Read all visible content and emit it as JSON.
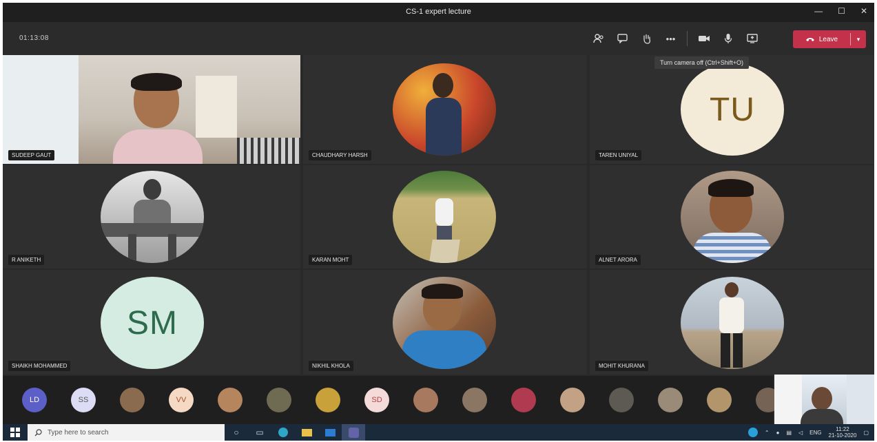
{
  "window": {
    "title": "CS-1 expert lecture",
    "controls": [
      "—",
      "☐",
      "✕"
    ]
  },
  "toolbar": {
    "timer": "01:13:08",
    "icons": [
      "participants-icon",
      "chat-icon",
      "raise-hand-icon",
      "more-actions-icon",
      "camera-icon",
      "mic-icon",
      "share-screen-icon"
    ],
    "leave_label": "Leave",
    "tooltip": "Turn camera off (Ctrl+Shift+O)"
  },
  "tiles": [
    {
      "name": "SUDEEP GAUT",
      "kind": "video"
    },
    {
      "name": "CHAUDHARY HARSH",
      "kind": "photo",
      "bg": "#c9462b"
    },
    {
      "name": "TAREN UNIYAL",
      "kind": "initials",
      "initials": "TU",
      "bg": "#f3ead8",
      "fg": "#7a5a1a"
    },
    {
      "name": "R ANIKETH",
      "kind": "photo",
      "bg": "#bdbdbd"
    },
    {
      "name": "KARAN MOHT",
      "kind": "photo",
      "bg": "#a9a06a"
    },
    {
      "name": "ALNET ARORA",
      "kind": "photo",
      "bg": "#8a7b6e"
    },
    {
      "name": "SHAIKH MOHAMMED",
      "kind": "initials",
      "initials": "SM",
      "bg": "#d5ece2",
      "fg": "#2e6b4c"
    },
    {
      "name": "NIKHIL KHOLA",
      "kind": "photo",
      "bg": "#7a6a58"
    },
    {
      "name": "MOHIT KHURANA",
      "kind": "photo",
      "bg": "#b8b4ae"
    }
  ],
  "roster": [
    {
      "text": "LD",
      "bg": "#5b5fc7",
      "fg": "#ffffff"
    },
    {
      "text": "SS",
      "bg": "#dcdcf5",
      "fg": "#555"
    },
    {
      "text": "",
      "bg": "#8a6b50",
      "fg": "#fff"
    },
    {
      "text": "VV",
      "bg": "#f6d9c4",
      "fg": "#a0502a"
    },
    {
      "text": "",
      "bg": "#b5865e",
      "fg": "#fff"
    },
    {
      "text": "",
      "bg": "#6f6a52",
      "fg": "#fff"
    },
    {
      "text": "",
      "bg": "#c9a13a",
      "fg": "#fff"
    },
    {
      "text": "SD",
      "bg": "#f5dada",
      "fg": "#b34040"
    },
    {
      "text": "",
      "bg": "#a77a5f",
      "fg": "#fff"
    },
    {
      "text": "",
      "bg": "#8b7663",
      "fg": "#fff"
    },
    {
      "text": "",
      "bg": "#b03a50",
      "fg": "#fff"
    },
    {
      "text": "",
      "bg": "#c2a184",
      "fg": "#fff"
    },
    {
      "text": "",
      "bg": "#5c5a52",
      "fg": "#fff"
    },
    {
      "text": "",
      "bg": "#9a8a78",
      "fg": "#fff"
    },
    {
      "text": "",
      "bg": "#b2956a",
      "fg": "#fff"
    },
    {
      "text": "",
      "bg": "#756355",
      "fg": "#fff"
    }
  ],
  "taskbar": {
    "search_placeholder": "Type here to search",
    "apps": [
      "cortana-icon",
      "task-view-icon",
      "edge-icon",
      "file-explorer-icon",
      "mail-icon",
      "teams-icon"
    ],
    "language": "ENG",
    "time": "11:22",
    "date": "21-10-2020"
  }
}
